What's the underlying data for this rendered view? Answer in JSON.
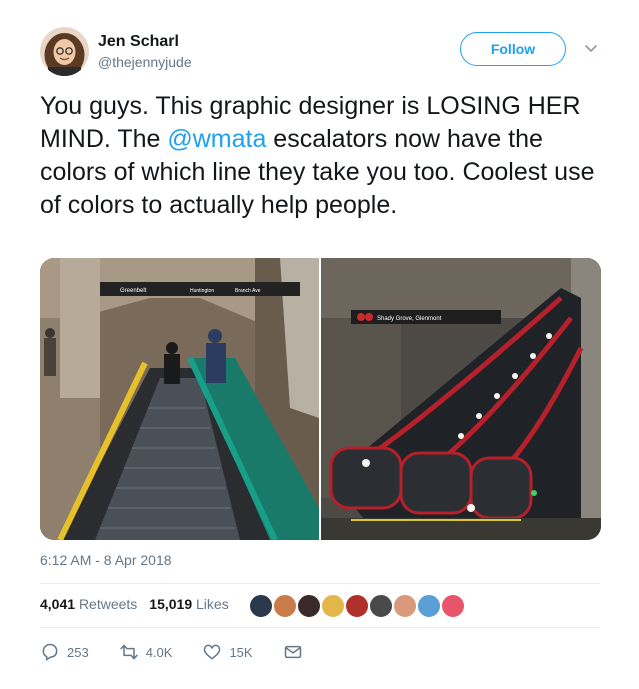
{
  "author": {
    "name": "Jen Scharl",
    "handle": "@thejennyjude"
  },
  "follow_label": "Follow",
  "tweet": {
    "text_before": "You guys. This graphic designer is LOSING HER MIND. The ",
    "mention": "@wmata",
    "text_after": " escalators now have the colors of which line they take you too. Coolest use of colors to actually help people."
  },
  "photos": {
    "left_sign_left": "Greenbelt",
    "left_sign_right": "Huntington",
    "left_sign_right2": "Branch Ave",
    "right_sign": "Shady Grove, Glenmont"
  },
  "timestamp": "6:12 AM - 8 Apr 2018",
  "stats": {
    "retweets_count": "4,041",
    "retweets_label": "Retweets",
    "likes_count": "15,019",
    "likes_label": "Likes"
  },
  "liker_colors": [
    "#2b3a4a",
    "#c97b4a",
    "#3a2b2b",
    "#e2b64a",
    "#b0302b",
    "#4a4a4a",
    "#d89a7a",
    "#5a9fd4",
    "#e8546a"
  ],
  "actions": {
    "replies": "253",
    "retweets": "4.0K",
    "likes": "15K"
  },
  "colors": {
    "accent": "#1da1f2",
    "secondary_text": "#657786"
  }
}
